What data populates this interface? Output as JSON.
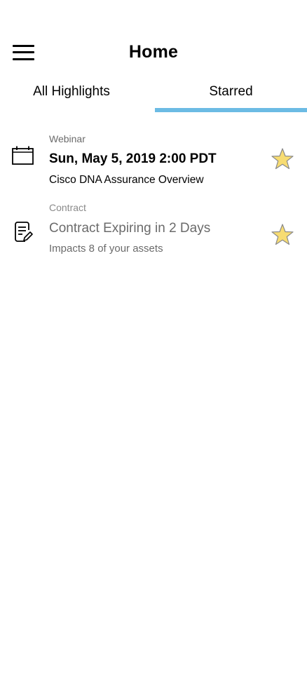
{
  "header": {
    "title": "Home",
    "menu_icon": "hamburger-menu-icon"
  },
  "tabs": [
    {
      "label": "All Highlights",
      "active": false
    },
    {
      "label": "Starred",
      "active": true
    }
  ],
  "colors": {
    "tab_indicator": "#6cbbe4",
    "star_fill": "#f7dc72",
    "star_stroke": "#8a8a8a",
    "muted_text": "#6b6b6b"
  },
  "items": [
    {
      "category": "Webinar",
      "headline": "Sun, May 5, 2019 2:00 PDT",
      "detail": "Cisco DNA Assurance Overview",
      "icon": "calendar-icon",
      "starred": true
    },
    {
      "category": "Contract",
      "headline": "Contract Expiring in 2 Days",
      "detail": "Impacts 8 of your assets",
      "icon": "contract-edit-icon",
      "starred": true
    }
  ]
}
